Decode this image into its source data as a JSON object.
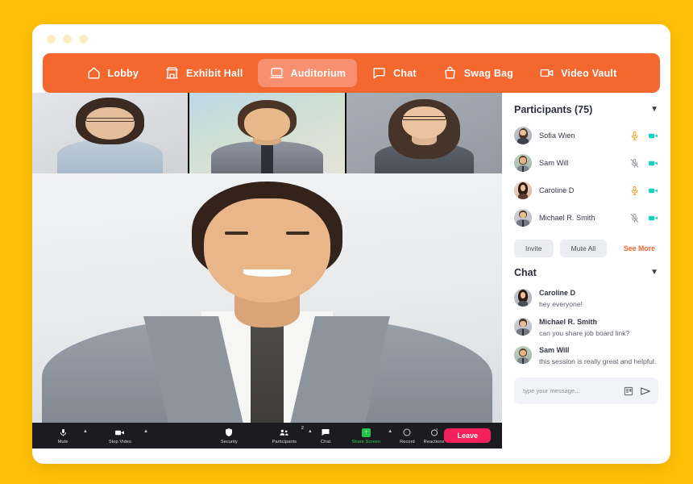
{
  "window": {
    "dots": [
      "dot-1",
      "dot-2",
      "dot-3"
    ]
  },
  "nav": {
    "items": [
      {
        "label": "Lobby",
        "icon": "home-icon",
        "active": false
      },
      {
        "label": "Exhibit Hall",
        "icon": "store-icon",
        "active": false
      },
      {
        "label": "Auditorium",
        "icon": "laptop-icon",
        "active": true
      },
      {
        "label": "Chat",
        "icon": "chat-bubble-icon",
        "active": false
      },
      {
        "label": "Swag Bag",
        "icon": "shopping-bag-icon",
        "active": false
      },
      {
        "label": "Video Vault",
        "icon": "video-camera-icon",
        "active": false
      }
    ]
  },
  "stage": {
    "thumbnails": [
      {
        "name": "thumbnail-participant-1"
      },
      {
        "name": "thumbnail-participant-2"
      },
      {
        "name": "thumbnail-participant-3"
      }
    ],
    "speaker": {
      "name": "active-speaker-video"
    },
    "toolbar": {
      "mute_label": "Mute",
      "stop_video_label": "Stop Video",
      "security_label": "Security",
      "participants_label": "Participants",
      "participants_count": "2",
      "chat_label": "Chat",
      "share_screen_label": "Share Screen",
      "record_label": "Record",
      "reactions_label": "Reactions",
      "leave_label": "Leave"
    }
  },
  "participants": {
    "title": "Participants (75)",
    "list": [
      {
        "name": "Sofia Wien",
        "mic": "mic-on",
        "camera": "camera-on"
      },
      {
        "name": "Sam Will",
        "mic": "mic-off",
        "camera": "camera-on"
      },
      {
        "name": "Caroline D",
        "mic": "mic-on",
        "camera": "camera-on"
      },
      {
        "name": "Michael R. Smith",
        "mic": "mic-off",
        "camera": "camera-on"
      }
    ],
    "invite_label": "Invite",
    "mute_all_label": "Mute All",
    "see_more_label": "See More"
  },
  "chat": {
    "title": "Chat",
    "messages": [
      {
        "author": "Caroline D",
        "text": "hey everyone!"
      },
      {
        "author": "Michael R. Smith",
        "text": "can you share job board link?"
      },
      {
        "author": "Sam Will",
        "text": "this session is really great and helpful."
      }
    ],
    "input_placeholder": "type your message..."
  },
  "colors": {
    "page_background": "#FFC107",
    "nav_bar": "#F4672F",
    "nav_active": "#F89070",
    "accent": "#F4672F",
    "mic_on": "#F5A623",
    "mic_off": "#9AA0A6",
    "camera_on": "#17D1C0",
    "leave": "#F5215B",
    "share_screen": "#27C24C"
  }
}
